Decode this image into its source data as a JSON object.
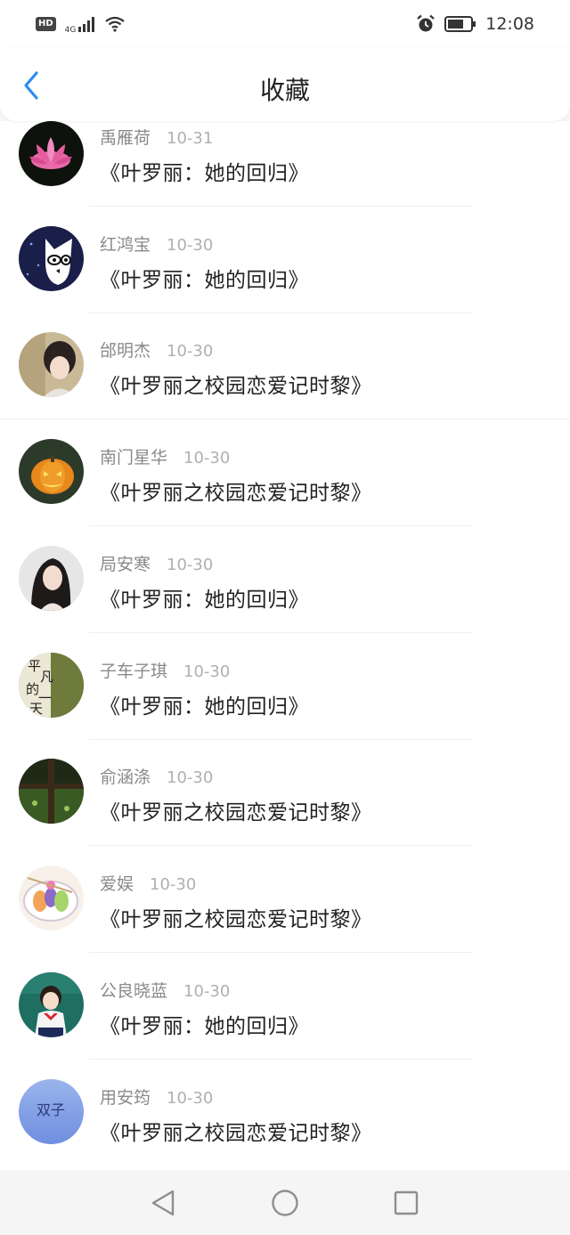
{
  "status_bar": {
    "hd": "HD",
    "network": "4G",
    "time": "12:08",
    "icons": [
      "hd-icon",
      "signal-icon",
      "wifi-icon",
      "alarm-icon",
      "battery-icon"
    ]
  },
  "header": {
    "title": "收藏",
    "back_icon": "chevron-left-icon",
    "accent_color": "#2d8cf0"
  },
  "items": [
    {
      "username": "禹雁荷",
      "date": "10-31",
      "title": "《叶罗丽：她的回归》",
      "avatar": "lotus-flower"
    },
    {
      "username": "红鸿宝",
      "date": "10-30",
      "title": "《叶罗丽：她的回归》",
      "avatar": "cartoon-cat"
    },
    {
      "username": "邰明杰",
      "date": "10-30",
      "title": "《叶罗丽之校园恋爱记时黎》",
      "avatar": "girl-portrait"
    },
    {
      "username": "南门星华",
      "date": "10-30",
      "title": "《叶罗丽之校园恋爱记时黎》",
      "avatar": "pumpkin-lantern"
    },
    {
      "username": "局安寒",
      "date": "10-30",
      "title": "《叶罗丽：她的回归》",
      "avatar": "woman-portrait"
    },
    {
      "username": "子车子琪",
      "date": "10-30",
      "title": "《叶罗丽：她的回归》",
      "avatar": "calligraphy-text"
    },
    {
      "username": "俞涵涤",
      "date": "10-30",
      "title": "《叶罗丽之校园恋爱记时黎》",
      "avatar": "window-cross"
    },
    {
      "username": "爱娱",
      "date": "10-30",
      "title": "《叶罗丽之校园恋爱记时黎》",
      "avatar": "food-bowl"
    },
    {
      "username": "公良晓蓝",
      "date": "10-30",
      "title": "《叶罗丽：她的回归》",
      "avatar": "child-uniform"
    },
    {
      "username": "用安筠",
      "date": "10-30",
      "title": "《叶罗丽之校园恋爱记时黎》",
      "avatar": "blue-gradient-text"
    }
  ],
  "nav_bar": {
    "back": "nav-back-icon",
    "home": "nav-home-icon",
    "recents": "nav-recents-icon"
  },
  "avatar_text": {
    "calligraphy": [
      "平",
      "凡",
      "的",
      "一",
      "天"
    ],
    "blue": "双子"
  }
}
